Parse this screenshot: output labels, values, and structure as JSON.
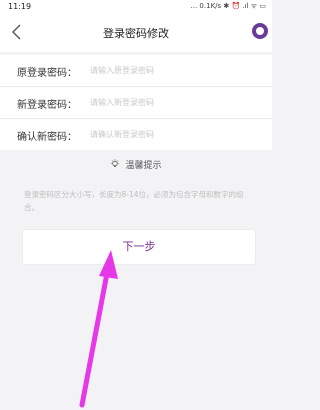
{
  "status_bar": {
    "time": "11:19",
    "indicators": "... 0.1K/s ✱ ⏰ .ıl ᯤ ▭"
  },
  "nav": {
    "title": "登录密码修改",
    "back_icon": "chevron-left-icon",
    "avatar_icon": "avatar-icon"
  },
  "form": {
    "rows": [
      {
        "label": "原登录密码：",
        "placeholder": "请输入原登录密码"
      },
      {
        "label": "新登录密码：",
        "placeholder": "请输入新登录密码"
      },
      {
        "label": "确认新密码：",
        "placeholder": "请确认新登录密码"
      }
    ]
  },
  "tips": {
    "title": "温馨提示",
    "text": "登录密码区分大小写，长度为8-14位，必须为包含字母和数字的组合。",
    "icon": "lightbulb-icon"
  },
  "next_button": {
    "label": "下一步"
  },
  "colors": {
    "accent": "#7a2b8f",
    "annotation_arrow": "#e637e8",
    "background": "#f3f3f5"
  }
}
